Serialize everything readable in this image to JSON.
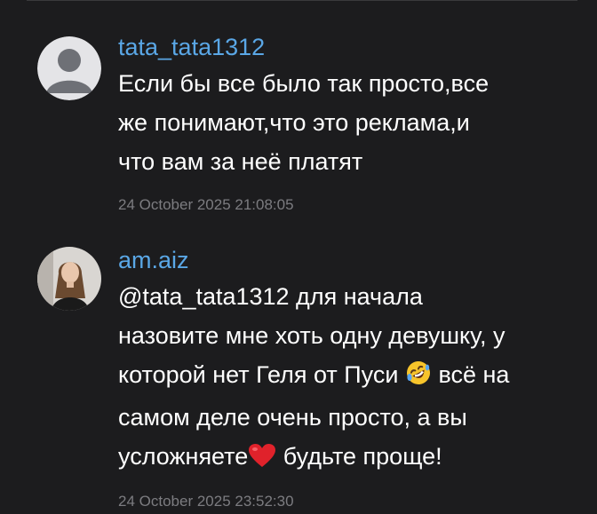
{
  "comments": [
    {
      "username": "tata_tata1312",
      "text_lines": [
        "Если бы все было так просто,все",
        "же понимают,что это реклама,и",
        "что вам за неё платят"
      ],
      "timestamp": "24 October 2025 21:08:05",
      "avatar_icon": "default-user-icon"
    },
    {
      "username": "am.aiz",
      "text_lines": [
        "@tata_tata1312 для начала",
        "назовите мне хоть одну девушку, у",
        "которой нет Геля от Пуси",
        "всё на",
        "самом деле очень просто, а вы",
        "усложняете",
        "будьте проще!"
      ],
      "emojis": [
        "rolling-on-floor-laughing-emoji",
        "red-heart-emoji"
      ],
      "timestamp": "24 October 2025 23:52:30",
      "avatar_icon": "user-photo-avatar"
    }
  ],
  "colors": {
    "background": "#1c1c1e",
    "username": "#5aa7e6",
    "text": "#ffffff",
    "timestamp": "#7c7c80"
  }
}
